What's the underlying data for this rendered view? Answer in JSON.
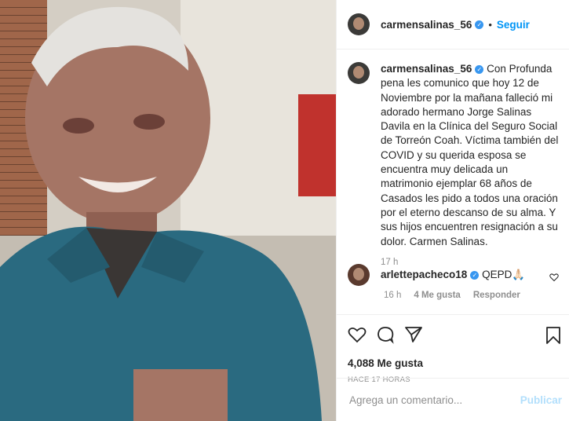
{
  "photo": {
    "description_icon": "photo"
  },
  "header": {
    "username": "carmensalinas_56",
    "separator": "•",
    "follow_label": "Seguir"
  },
  "caption": {
    "username": "carmensalinas_56",
    "text": "Con Profunda pena les comunico que hoy 12 de Noviembre por la mañana falleció mi adorado hermano Jorge Salinas Davila en la Clínica del Seguro Social de Torreón Coah. Víctima también del COVID y su querida esposa se encuentra muy delicada un matrimonio ejemplar 68 años de Casados les pido a todos una oración por el eterno descanso de su alma. Y sus hijos encuentren resignación a su dolor. Carmen Salinas.",
    "time": "17 h"
  },
  "comment": {
    "username": "arlettepacheco18",
    "text": "QEPD🙏🏻",
    "time": "16 h",
    "likes": "4 Me gusta",
    "reply": "Responder"
  },
  "stats": {
    "likes": "4,088 Me gusta",
    "ago": "HACE 17 HORAS"
  },
  "add_comment": {
    "placeholder": "Agrega un comentario...",
    "publish": "Publicar"
  },
  "colors": {
    "accent": "#0095f6",
    "muted": "#8e8e8e",
    "publish_disabled": "#b2dffc"
  }
}
